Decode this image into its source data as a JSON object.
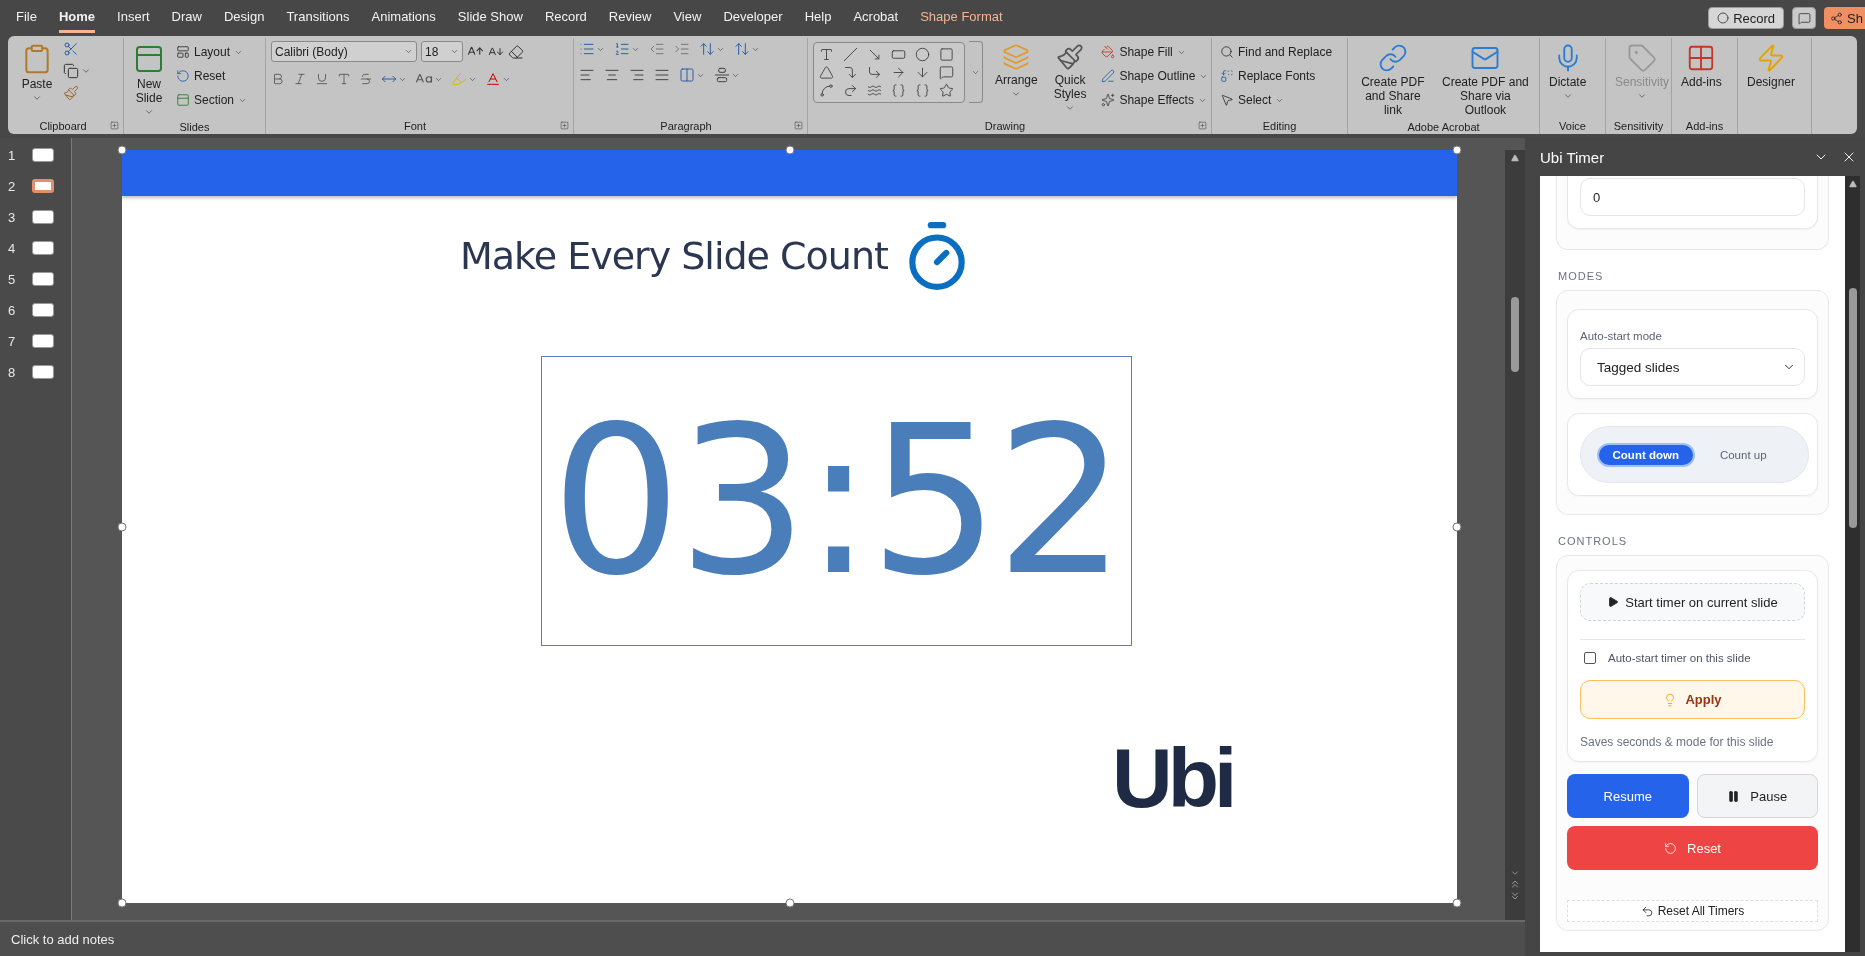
{
  "menu_tabs": [
    {
      "label": "File",
      "selected": false,
      "kind": "standard"
    },
    {
      "label": "Home",
      "selected": true,
      "kind": "standard"
    },
    {
      "label": "Insert",
      "selected": false,
      "kind": "standard"
    },
    {
      "label": "Draw",
      "selected": false,
      "kind": "standard"
    },
    {
      "label": "Design",
      "selected": false,
      "kind": "standard"
    },
    {
      "label": "Transitions",
      "selected": false,
      "kind": "standard"
    },
    {
      "label": "Animations",
      "selected": false,
      "kind": "standard"
    },
    {
      "label": "Slide Show",
      "selected": false,
      "kind": "standard"
    },
    {
      "label": "Record",
      "selected": false,
      "kind": "standard"
    },
    {
      "label": "Review",
      "selected": false,
      "kind": "standard"
    },
    {
      "label": "View",
      "selected": false,
      "kind": "standard"
    },
    {
      "label": "Developer",
      "selected": false,
      "kind": "standard"
    },
    {
      "label": "Help",
      "selected": false,
      "kind": "standard"
    },
    {
      "label": "Acrobat",
      "selected": false,
      "kind": "standard"
    },
    {
      "label": "Shape Format",
      "selected": false,
      "kind": "contextual"
    }
  ],
  "title_actions": {
    "record": "Record",
    "share": "Sh"
  },
  "ribbon": [
    {
      "kind": "clipboard",
      "label": "Clipboard",
      "paste": "Paste"
    },
    {
      "kind": "slides",
      "label": "Slides",
      "new_slide": "New\nSlide",
      "commands": [
        {
          "label": "Layout",
          "dropdown": true
        },
        {
          "label": "Reset",
          "dropdown": false
        },
        {
          "label": "Section",
          "dropdown": true
        }
      ]
    },
    {
      "kind": "font",
      "label": "Font",
      "font_name": "Calibri (Body)",
      "font_size": "18"
    },
    {
      "kind": "paragraph",
      "label": "Paragraph"
    },
    {
      "kind": "drawing",
      "label": "Drawing",
      "arrange": "Arrange",
      "quick_styles": "Quick\nStyles",
      "commands": [
        {
          "label": "Shape Fill",
          "dropdown": true
        },
        {
          "label": "Shape Outline",
          "dropdown": true
        },
        {
          "label": "Shape Effects",
          "dropdown": true
        }
      ]
    },
    {
      "kind": "editing",
      "label": "Editing",
      "commands": [
        {
          "label": "Find and Replace",
          "dropdown": false
        },
        {
          "label": "Replace Fonts",
          "dropdown": false
        },
        {
          "label": "Select",
          "dropdown": true
        }
      ]
    },
    {
      "kind": "buttons",
      "label": "Adobe Acrobat",
      "buttons": [
        {
          "kind": "pdflink",
          "label": "Create PDF\nand Share link",
          "disabled": false
        },
        {
          "kind": "pdfmail",
          "label": "Create PDF and\nShare via Outlook",
          "disabled": false
        }
      ]
    },
    {
      "kind": "buttons",
      "label": "Voice",
      "buttons": [
        {
          "kind": "dictate",
          "label": "Dictate",
          "disabled": false
        }
      ]
    },
    {
      "kind": "buttons",
      "label": "Sensitivity",
      "buttons": [
        {
          "kind": "sensitivity",
          "label": "Sensitivity",
          "disabled": true
        }
      ]
    },
    {
      "kind": "buttons",
      "label": "Add-ins",
      "buttons": [
        {
          "kind": "addins",
          "label": "Add-ins",
          "disabled": false
        }
      ]
    },
    {
      "kind": "buttons",
      "buttons": [
        {
          "kind": "designer",
          "label": "Designer",
          "disabled": false
        }
      ]
    }
  ],
  "slides": [
    {
      "number": "1",
      "selected": false
    },
    {
      "number": "2",
      "selected": true
    },
    {
      "number": "3",
      "selected": false
    },
    {
      "number": "4",
      "selected": false
    },
    {
      "number": "5",
      "selected": false
    },
    {
      "number": "6",
      "selected": false
    },
    {
      "number": "7",
      "selected": false
    },
    {
      "number": "8",
      "selected": false
    }
  ],
  "slide": {
    "title": "Make Every Slide Count",
    "timer": "03:52",
    "logo": "Ubi"
  },
  "notes": {
    "placeholder": "Click to add notes"
  },
  "task_pane": {
    "title": "Ubi Timer",
    "seconds_value": "0",
    "modes_heading": "MODES",
    "auto_start_label": "Auto-start mode",
    "auto_start_value": "Tagged slides",
    "direction_options": [
      {
        "label": "Count down",
        "selected": true
      },
      {
        "label": "Count up",
        "selected": false
      }
    ],
    "controls_heading": "CONTROLS",
    "start_button": "Start timer on current slide",
    "auto_start_checkbox": {
      "label": "Auto-start timer on this slide",
      "checked": false
    },
    "apply_button": "Apply",
    "apply_hint": "Saves seconds & mode for this slide",
    "resume_button": "Resume",
    "pause_button": "Pause",
    "reset_button": "Reset",
    "reset_all_button": "Reset All Timers"
  }
}
